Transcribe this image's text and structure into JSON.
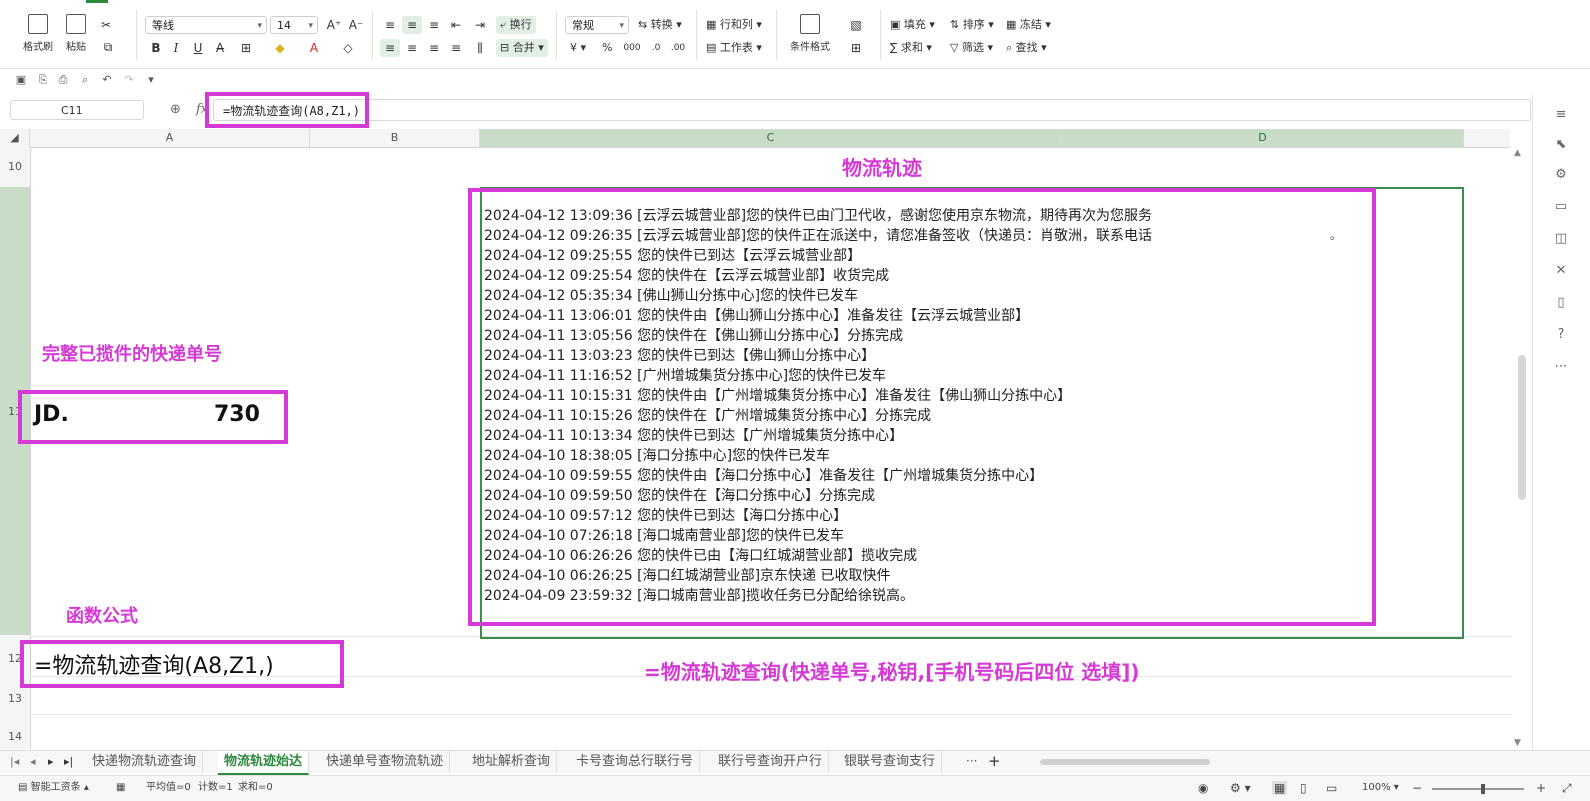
{
  "ribbon": {
    "format_painter": "格式刷",
    "paste": "粘贴",
    "font_name": "等线",
    "font_size": "14",
    "wrap": "换行",
    "number_format": "常规",
    "convert": "转换",
    "rows_cols": "行和列",
    "worksheet": "工作表",
    "cond_format": "条件格式",
    "fill": "填充",
    "sort": "排序",
    "freeze": "冻结",
    "sum": "求和",
    "filter": "筛选",
    "find": "查找",
    "merge": "合并",
    "currency_symbol": "¥",
    "percent_symbol": "%"
  },
  "formula_bar": {
    "cell_ref": "C11",
    "formula": "=物流轨迹查询(A8,Z1,)"
  },
  "columns": [
    "A",
    "B",
    "C",
    "D"
  ],
  "rows": [
    "10",
    "11",
    "12",
    "13",
    "14"
  ],
  "sheet": {
    "title": "物流轨迹",
    "tracking_label": "完整已揽件的快递单号",
    "tracking_prefix": "JD.",
    "tracking_suffix": "730",
    "formula_label": "函数公式",
    "formula_value": "=物流轨迹查询(A8,Z1,)",
    "syntax": "=物流轨迹查询(快递单号,秘钥,[手机号码后四位 选填])",
    "log_lines": [
      "2024-04-12 13:09:36 [云浮云城营业部]您的快件已由门卫代收，感谢您使用京东物流，期待再次为您服务",
      "2024-04-12 09:26:35 [云浮云城营业部]您的快件正在派送中，请您准备签收（快递员：肖敬洲，联系电话",
      "2024-04-12 09:25:55 您的快件已到达【云浮云城营业部】",
      "2024-04-12 09:25:54 您的快件在【云浮云城营业部】收货完成",
      "2024-04-12 05:35:34 [佛山狮山分拣中心]您的快件已发车",
      "2024-04-11 13:06:01 您的快件由【佛山狮山分拣中心】准备发往【云浮云城营业部】",
      "2024-04-11 13:05:56 您的快件在【佛山狮山分拣中心】分拣完成",
      "2024-04-11 13:03:23 您的快件已到达【佛山狮山分拣中心】",
      "2024-04-11 11:16:52 [广州增城集货分拣中心]您的快件已发车",
      "2024-04-11 10:15:31 您的快件由【广州增城集货分拣中心】准备发往【佛山狮山分拣中心】",
      "2024-04-11 10:15:26 您的快件在【广州增城集货分拣中心】分拣完成",
      "2024-04-11 10:13:34 您的快件已到达【广州增城集货分拣中心】",
      "2024-04-10 18:38:05 [海口分拣中心]您的快件已发车",
      "2024-04-10 09:59:55 您的快件由【海口分拣中心】准备发往【广州增城集货分拣中心】",
      "2024-04-10 09:59:50 您的快件在【海口分拣中心】分拣完成",
      "2024-04-10 09:57:12 您的快件已到达【海口分拣中心】",
      "2024-04-10 07:26:18 [海口城南营业部]您的快件已发车",
      "2024-04-10 06:26:26 您的快件已由【海口红城湖营业部】揽收完成",
      "2024-04-10 06:26:25 [海口红城湖营业部]京东快递 已收取快件",
      "2024-04-09 23:59:32 [海口城南营业部]揽收任务已分配给徐锐高。"
    ],
    "overflow_mark": "。"
  },
  "tabs": {
    "items": [
      "快递物流轨迹查询",
      "物流轨迹始达",
      "快递单号查物流轨迹",
      "地址解析查询",
      "卡号查询总行联行号",
      "联行号查询开户行",
      "银联号查询支行"
    ],
    "active_index": 1,
    "more": "···",
    "add": "+"
  },
  "status": {
    "app_mode": "智能工资条",
    "average": "平均值=0",
    "count": "计数=1",
    "sum": "求和=0",
    "zoom": "100%"
  },
  "colors": {
    "annotation": "#d63ad6",
    "selection_green": "#3a8d4a",
    "active_tab": "#2b8a3e"
  }
}
